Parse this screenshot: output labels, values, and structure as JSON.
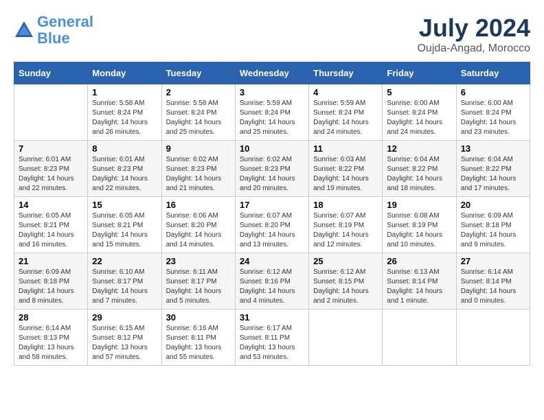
{
  "logo": {
    "line1": "General",
    "line2": "Blue"
  },
  "title": "July 2024",
  "location": "Oujda-Angad, Morocco",
  "weekdays": [
    "Sunday",
    "Monday",
    "Tuesday",
    "Wednesday",
    "Thursday",
    "Friday",
    "Saturday"
  ],
  "weeks": [
    [
      {
        "day": "",
        "info": ""
      },
      {
        "day": "1",
        "info": "Sunrise: 5:58 AM\nSunset: 8:24 PM\nDaylight: 14 hours\nand 26 minutes."
      },
      {
        "day": "2",
        "info": "Sunrise: 5:58 AM\nSunset: 8:24 PM\nDaylight: 14 hours\nand 25 minutes."
      },
      {
        "day": "3",
        "info": "Sunrise: 5:59 AM\nSunset: 8:24 PM\nDaylight: 14 hours\nand 25 minutes."
      },
      {
        "day": "4",
        "info": "Sunrise: 5:59 AM\nSunset: 8:24 PM\nDaylight: 14 hours\nand 24 minutes."
      },
      {
        "day": "5",
        "info": "Sunrise: 6:00 AM\nSunset: 8:24 PM\nDaylight: 14 hours\nand 24 minutes."
      },
      {
        "day": "6",
        "info": "Sunrise: 6:00 AM\nSunset: 8:24 PM\nDaylight: 14 hours\nand 23 minutes."
      }
    ],
    [
      {
        "day": "7",
        "info": "Sunrise: 6:01 AM\nSunset: 8:23 PM\nDaylight: 14 hours\nand 22 minutes."
      },
      {
        "day": "8",
        "info": "Sunrise: 6:01 AM\nSunset: 8:23 PM\nDaylight: 14 hours\nand 22 minutes."
      },
      {
        "day": "9",
        "info": "Sunrise: 6:02 AM\nSunset: 8:23 PM\nDaylight: 14 hours\nand 21 minutes."
      },
      {
        "day": "10",
        "info": "Sunrise: 6:02 AM\nSunset: 8:23 PM\nDaylight: 14 hours\nand 20 minutes."
      },
      {
        "day": "11",
        "info": "Sunrise: 6:03 AM\nSunset: 8:22 PM\nDaylight: 14 hours\nand 19 minutes."
      },
      {
        "day": "12",
        "info": "Sunrise: 6:04 AM\nSunset: 8:22 PM\nDaylight: 14 hours\nand 18 minutes."
      },
      {
        "day": "13",
        "info": "Sunrise: 6:04 AM\nSunset: 8:22 PM\nDaylight: 14 hours\nand 17 minutes."
      }
    ],
    [
      {
        "day": "14",
        "info": "Sunrise: 6:05 AM\nSunset: 8:21 PM\nDaylight: 14 hours\nand 16 minutes."
      },
      {
        "day": "15",
        "info": "Sunrise: 6:05 AM\nSunset: 8:21 PM\nDaylight: 14 hours\nand 15 minutes."
      },
      {
        "day": "16",
        "info": "Sunrise: 6:06 AM\nSunset: 8:20 PM\nDaylight: 14 hours\nand 14 minutes."
      },
      {
        "day": "17",
        "info": "Sunrise: 6:07 AM\nSunset: 8:20 PM\nDaylight: 14 hours\nand 13 minutes."
      },
      {
        "day": "18",
        "info": "Sunrise: 6:07 AM\nSunset: 8:19 PM\nDaylight: 14 hours\nand 12 minutes."
      },
      {
        "day": "19",
        "info": "Sunrise: 6:08 AM\nSunset: 8:19 PM\nDaylight: 14 hours\nand 10 minutes."
      },
      {
        "day": "20",
        "info": "Sunrise: 6:09 AM\nSunset: 8:18 PM\nDaylight: 14 hours\nand 9 minutes."
      }
    ],
    [
      {
        "day": "21",
        "info": "Sunrise: 6:09 AM\nSunset: 8:18 PM\nDaylight: 14 hours\nand 8 minutes."
      },
      {
        "day": "22",
        "info": "Sunrise: 6:10 AM\nSunset: 8:17 PM\nDaylight: 14 hours\nand 7 minutes."
      },
      {
        "day": "23",
        "info": "Sunrise: 6:11 AM\nSunset: 8:17 PM\nDaylight: 14 hours\nand 5 minutes."
      },
      {
        "day": "24",
        "info": "Sunrise: 6:12 AM\nSunset: 8:16 PM\nDaylight: 14 hours\nand 4 minutes."
      },
      {
        "day": "25",
        "info": "Sunrise: 6:12 AM\nSunset: 8:15 PM\nDaylight: 14 hours\nand 2 minutes."
      },
      {
        "day": "26",
        "info": "Sunrise: 6:13 AM\nSunset: 8:14 PM\nDaylight: 14 hours\nand 1 minute."
      },
      {
        "day": "27",
        "info": "Sunrise: 6:14 AM\nSunset: 8:14 PM\nDaylight: 14 hours\nand 0 minutes."
      }
    ],
    [
      {
        "day": "28",
        "info": "Sunrise: 6:14 AM\nSunset: 8:13 PM\nDaylight: 13 hours\nand 58 minutes."
      },
      {
        "day": "29",
        "info": "Sunrise: 6:15 AM\nSunset: 8:12 PM\nDaylight: 13 hours\nand 57 minutes."
      },
      {
        "day": "30",
        "info": "Sunrise: 6:16 AM\nSunset: 8:11 PM\nDaylight: 13 hours\nand 55 minutes."
      },
      {
        "day": "31",
        "info": "Sunrise: 6:17 AM\nSunset: 8:11 PM\nDaylight: 13 hours\nand 53 minutes."
      },
      {
        "day": "",
        "info": ""
      },
      {
        "day": "",
        "info": ""
      },
      {
        "day": "",
        "info": ""
      }
    ]
  ]
}
